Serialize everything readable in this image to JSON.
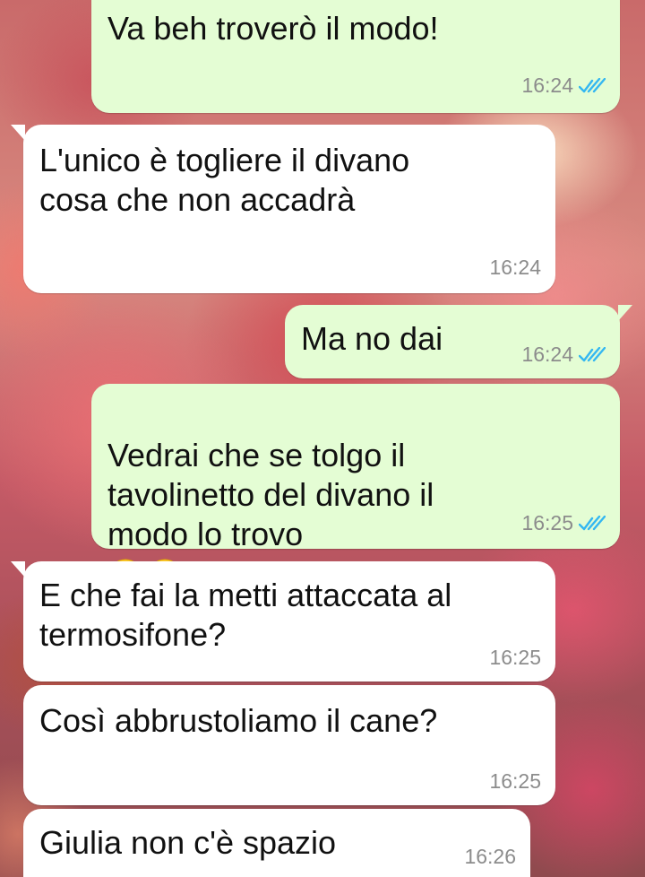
{
  "messages": [
    {
      "direction": "out",
      "text": "Va beh troverò il modo!",
      "time": "16:24",
      "status": "read"
    },
    {
      "direction": "in",
      "text": "L'unico è togliere il divano\ncosa che non accadrà",
      "time": "16:24"
    },
    {
      "direction": "out",
      "text": "Ma no dai",
      "time": "16:24",
      "status": "read"
    },
    {
      "direction": "out",
      "text": "Vedrai che se tolgo il\ntavolinetto del divano il\nmodo lo trovo",
      "emoji": "😊😊",
      "time": "16:25",
      "status": "read"
    },
    {
      "direction": "in",
      "text": "E che fai la metti attaccata al\ntermosifone?",
      "time": "16:25"
    },
    {
      "direction": "in",
      "text": "Così abbrustoliamo il cane?",
      "time": "16:25"
    },
    {
      "direction": "in",
      "text": "Giulia non c'è spazio",
      "time": "16:26"
    }
  ],
  "colors": {
    "outgoing_bubble": "#e4fdd4",
    "incoming_bubble": "#ffffff",
    "read_ticks": "#34b7f1",
    "timestamp": "#8c8c8c"
  },
  "icons": {
    "read_status": "double-check-icon",
    "emoji": "smiling-face-icon"
  }
}
